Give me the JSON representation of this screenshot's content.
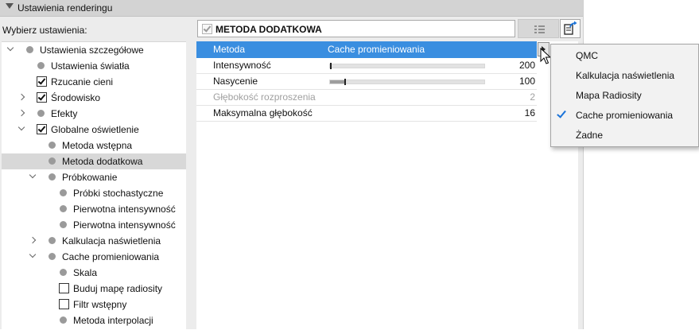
{
  "panel_title": "Ustawienia renderingu",
  "choose_label": "Wybierz ustawienia:",
  "tree": [
    {
      "label": "Ustawienia szczegółowe",
      "chevron": "down",
      "marker": "dot",
      "indent": 0,
      "selected": false
    },
    {
      "label": "Ustawienia światła",
      "chevron": "",
      "marker": "dot",
      "indent": 1,
      "selected": false
    },
    {
      "label": "Rzucanie cieni",
      "chevron": "",
      "marker": "check",
      "indent": 1,
      "selected": false
    },
    {
      "label": "Środowisko",
      "chevron": "right",
      "marker": "check",
      "indent": 1,
      "selected": false
    },
    {
      "label": "Efekty",
      "chevron": "right",
      "marker": "dot",
      "indent": 1,
      "selected": false
    },
    {
      "label": "Globalne oświetlenie",
      "chevron": "down",
      "marker": "check",
      "indent": 1,
      "selected": false
    },
    {
      "label": "Metoda wstępna",
      "chevron": "",
      "marker": "dot",
      "indent": 2,
      "selected": false
    },
    {
      "label": "Metoda dodatkowa",
      "chevron": "",
      "marker": "dot",
      "indent": 2,
      "selected": true
    },
    {
      "label": "Próbkowanie",
      "chevron": "down",
      "marker": "dot",
      "indent": 2,
      "selected": false
    },
    {
      "label": "Próbki stochastyczne",
      "chevron": "",
      "marker": "dot",
      "indent": 3,
      "selected": false
    },
    {
      "label": "Pierwotna intensywność",
      "chevron": "",
      "marker": "dot",
      "indent": 3,
      "selected": false
    },
    {
      "label": "Pierwotna intensywność",
      "chevron": "",
      "marker": "dot",
      "indent": 3,
      "selected": false
    },
    {
      "label": "Kalkulacja naświetlenia",
      "chevron": "right",
      "marker": "dot",
      "indent": 2,
      "selected": false
    },
    {
      "label": "Cache promieniowania",
      "chevron": "down",
      "marker": "dot",
      "indent": 2,
      "selected": false
    },
    {
      "label": "Skala",
      "chevron": "",
      "marker": "dot",
      "indent": 3,
      "selected": false
    },
    {
      "label": "Buduj mapę radiosity",
      "chevron": "",
      "marker": "box",
      "indent": 3,
      "selected": false
    },
    {
      "label": "Filtr wstępny",
      "chevron": "",
      "marker": "box",
      "indent": 3,
      "selected": false
    },
    {
      "label": "Metoda interpolacji",
      "chevron": "",
      "marker": "dot",
      "indent": 3,
      "selected": false
    }
  ],
  "section": {
    "title": "METODA DODATKOWA",
    "enabled": true
  },
  "properties": [
    {
      "label": "Metoda",
      "value": "Cache promieniowania",
      "selected": true,
      "disabled": false
    },
    {
      "label": "Intensywność",
      "value": "200",
      "slider": 0.005,
      "selected": false,
      "disabled": false
    },
    {
      "label": "Nasycenie",
      "value": "100",
      "slider": 0.1,
      "selected": false,
      "disabled": false
    },
    {
      "label": "Głębokość rozproszenia",
      "value": "2",
      "selected": false,
      "disabled": true
    },
    {
      "label": "Maksymalna głębokość",
      "value": "16",
      "selected": false,
      "disabled": false
    }
  ],
  "dropdown": {
    "options": [
      "QMC",
      "Kalkulacja naświetlenia",
      "Mapa Radiosity",
      "Cache promieniowania",
      "Żadne"
    ],
    "selected": "Cache promieniowania"
  },
  "icons": {
    "list_button": "list-view-icon",
    "export_button": "export-settings-icon",
    "dropdown_arrow": "play-arrow-icon",
    "cursor": "mouse-pointer-icon",
    "collapse": "triangle-down-icon"
  },
  "colors": {
    "selection": "#3a8ee0",
    "check_accent": "#1a73d9",
    "tree_selected": "#d8d8d8"
  }
}
